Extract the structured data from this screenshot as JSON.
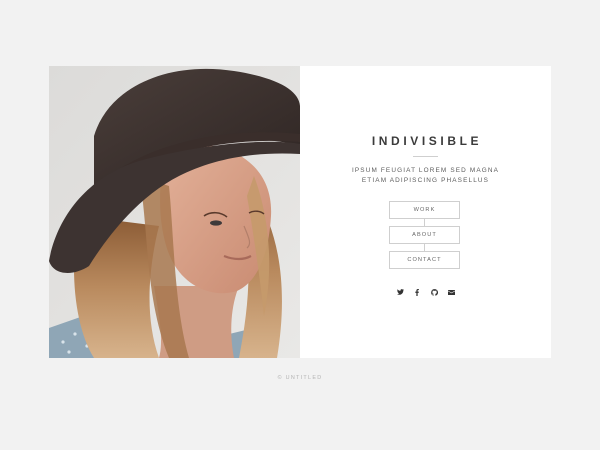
{
  "site": {
    "title": "INDIVISIBLE",
    "tagline_line1": "IPSUM FEUGIAT LOREM SED MAGNA",
    "tagline_line2": "ETIAM ADIPISCING PHASELLUS"
  },
  "nav": {
    "items": [
      {
        "label": "WORK"
      },
      {
        "label": "ABOUT"
      },
      {
        "label": "CONTACT"
      }
    ]
  },
  "social": {
    "icons": [
      "twitter-icon",
      "facebook-icon",
      "github-icon",
      "envelope-icon"
    ]
  },
  "footer": {
    "credit": "© UNTITLED"
  },
  "colors": {
    "background": "#f2f2f2",
    "panel": "#ffffff",
    "text_dark": "#3b3b3b",
    "border": "#cfcfcf"
  }
}
